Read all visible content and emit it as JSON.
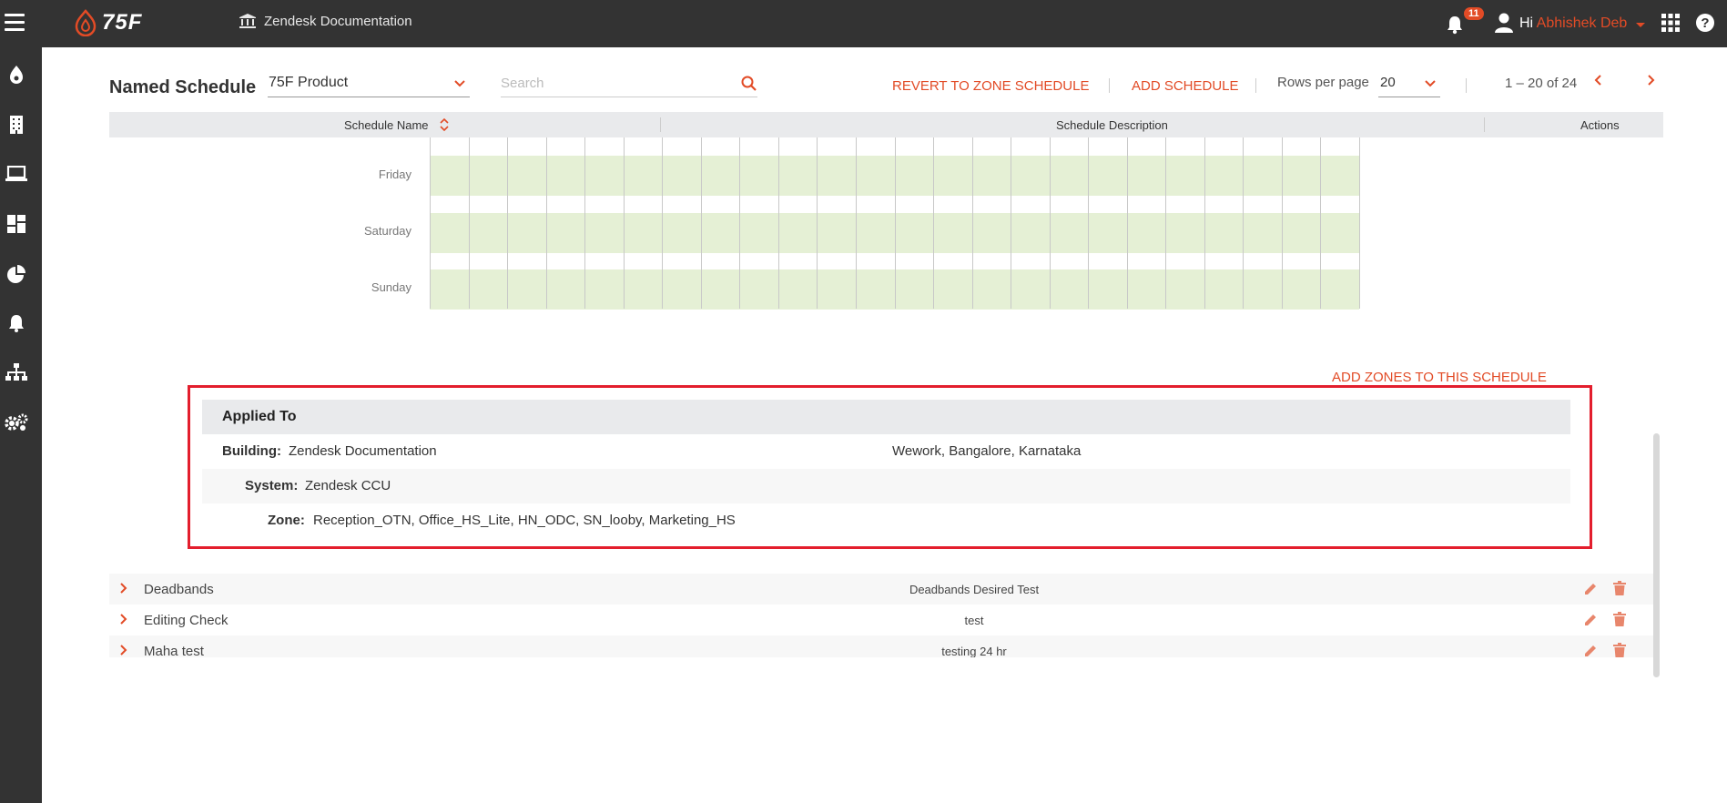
{
  "topbar": {
    "logo_text": "75F",
    "site_name": "Zendesk Documentation",
    "notification_count": "11",
    "greeting": "Hi",
    "user_name": "Abhishek Deb"
  },
  "toolbar": {
    "title": "Named Schedule",
    "product_value": "75F Product",
    "search_placeholder": "Search",
    "revert_label": "REVERT TO ZONE SCHEDULE",
    "add_schedule_label": "ADD SCHEDULE",
    "rows_per_page_label": "Rows per page",
    "rows_per_page_value": "20",
    "page_range": "1 – 20 of 24"
  },
  "table": {
    "columns": [
      "Schedule Name",
      "Schedule Description",
      "Actions"
    ]
  },
  "schedule_grid": {
    "days": [
      "Friday",
      "Saturday",
      "Sunday"
    ]
  },
  "add_zones_label": "ADD ZONES TO THIS SCHEDULE",
  "applied_to": {
    "heading": "Applied To",
    "building_label": "Building:",
    "building_value": "Zendesk Documentation",
    "building_location": "Wework, Bangalore, Karnataka",
    "system_label": "System:",
    "system_value": "Zendesk CCU",
    "zone_label": "Zone:",
    "zone_value": "Reception_OTN, Office_HS_Lite, HN_ODC, SN_looby, Marketing_HS"
  },
  "rows": [
    {
      "name": "Deadbands",
      "description": "Deadbands Desired Test"
    },
    {
      "name": "Editing Check",
      "description": "test"
    },
    {
      "name": "Maha test",
      "description": "testing 24 hr"
    }
  ],
  "colors": {
    "accent": "#e24b26",
    "highlight_border": "#e31e2d",
    "grid_fill": "#e5f0d5",
    "topbar": "#333333"
  }
}
